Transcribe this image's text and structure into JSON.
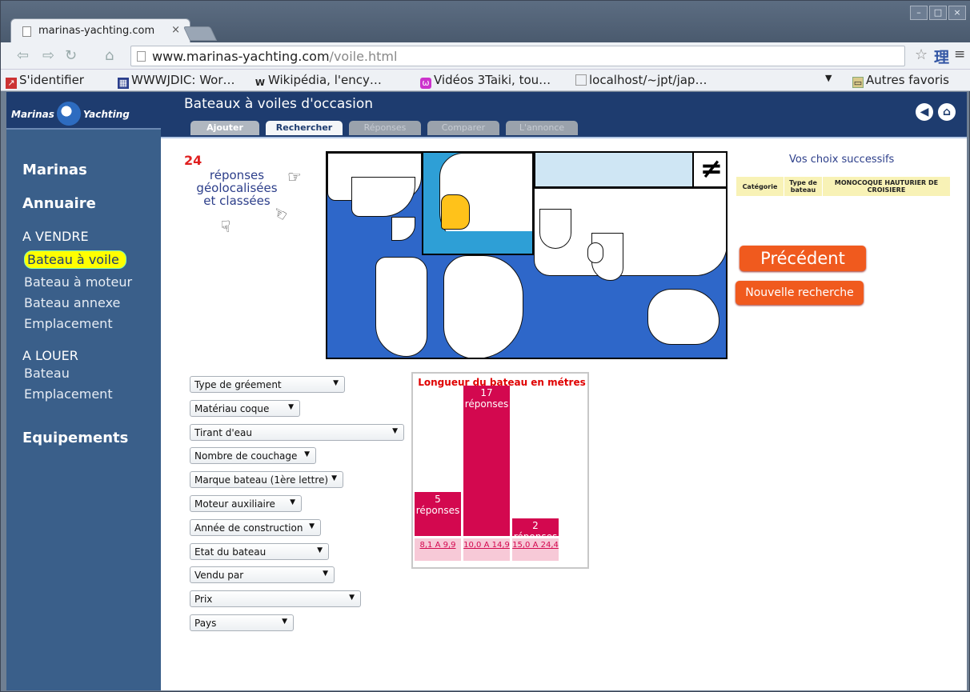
{
  "browser": {
    "tab_title": "marinas-yachting.com",
    "tab_close": "×",
    "url_host": "www.marinas-yachting.com",
    "url_path": "/voile.html",
    "bookmarks": [
      "S'identifier",
      "WWWJDIC: Wor…",
      "Wikipédia, l'ency…",
      "Vidéos 3Taiki, tou…",
      "localhost/~jpt/jap…"
    ],
    "other_bookmarks": "Autres favoris",
    "bookmark_menu_arrow": "▼"
  },
  "site": {
    "logo_left": "Marinas",
    "logo_right": "Yachting",
    "page_title": "Bateaux à voiles d'occasion",
    "tabs": [
      {
        "label": "Ajouter",
        "state": "enabled"
      },
      {
        "label": "Rechercher",
        "state": "active"
      },
      {
        "label": "Réponses",
        "state": "disabled"
      },
      {
        "label": "Comparer",
        "state": "disabled"
      },
      {
        "label": "L'annonce",
        "state": "disabled"
      }
    ]
  },
  "sidebar": {
    "marinas": "Marinas",
    "annuaire": "Annuaire",
    "a_vendre": "A VENDRE",
    "vendre_items": [
      "Bateau à voile",
      "Bateau à moteur",
      "Bateau annexe",
      "Emplacement"
    ],
    "a_louer": "A LOUER",
    "louer_items": [
      "Bateau",
      "Emplacement"
    ],
    "equipements": "Equipements"
  },
  "results": {
    "count": "24",
    "line1": "réponses",
    "line2": "géolocalisées",
    "line3": "et classées"
  },
  "map": {
    "not_equal_symbol": "≠"
  },
  "choices": {
    "title": "Vos choix successifs",
    "col1": "Catégorie",
    "col2": "Type de bateau",
    "col3": "MONOCOQUE HAUTURIER DE CROISIERE"
  },
  "buttons": {
    "previous": "Précédent",
    "new_search": "Nouvelle recherche"
  },
  "filters": [
    {
      "label": "Type de gréement"
    },
    {
      "label": "Matériau coque"
    },
    {
      "label": "Tirant d'eau"
    },
    {
      "label": "Nombre de couchage"
    },
    {
      "label": "Marque bateau (1ère lettre)"
    },
    {
      "label": "Moteur auxiliaire"
    },
    {
      "label": "Année de construction"
    },
    {
      "label": "Etat du bateau"
    },
    {
      "label": "Vendu par"
    },
    {
      "label": "Prix"
    },
    {
      "label": "Pays"
    }
  ],
  "chart_data": {
    "type": "bar",
    "title": "Longueur du bateau en métres",
    "categories": [
      "8,1 A 9,9",
      "10,0 A 14,9",
      "15,0 A 24,4"
    ],
    "values": [
      5,
      17,
      2
    ],
    "value_suffix": "réponses",
    "color": "#d3084f"
  }
}
